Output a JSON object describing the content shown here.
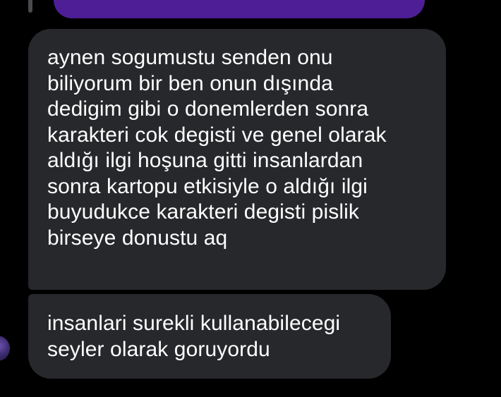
{
  "thread": {
    "messages": [
      {
        "direction": "received",
        "text": "aynen sogumustu senden onu\nbiliyorum bir ben onun dışında\ndedigim gibi o donemlerden sonra\nkarakteri cok degisti ve genel olarak\naldığı ilgi hoşuna gitti insanlardan\nsonra kartopu etkisiyle o aldığı ilgi\nbuyudukce karakteri degisti pislik\nbirseye donustu aq"
      },
      {
        "direction": "received",
        "text": "insanlari surekli kullanabilecegi\nseyler olarak goruyordu"
      }
    ]
  },
  "colors": {
    "background": "#000000",
    "received_bubble": "#26282b",
    "sent_bubble": "#4e1e96",
    "text": "#ffffff"
  }
}
